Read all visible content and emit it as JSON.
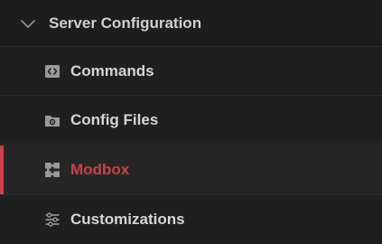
{
  "section": {
    "title": "Server Configuration",
    "expanded": true
  },
  "items": [
    {
      "label": "Commands",
      "icon": "code-icon",
      "active": false
    },
    {
      "label": "Config Files",
      "icon": "folder-gear-icon",
      "active": false
    },
    {
      "label": "Modbox",
      "icon": "puzzle-icon",
      "active": true
    },
    {
      "label": "Customizations",
      "icon": "sliders-icon",
      "active": false
    }
  ],
  "colors": {
    "background": "#1f1f1f",
    "text": "#d6d6d6",
    "accent": "#c9434a",
    "icon": "#9a9a9a"
  }
}
